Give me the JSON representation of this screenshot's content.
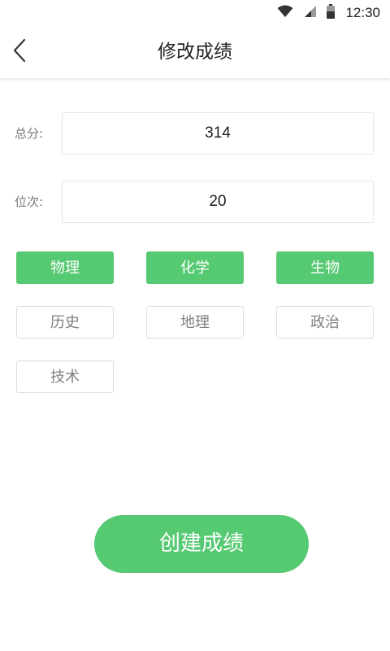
{
  "status_bar": {
    "time": "12:30",
    "icons": [
      "wifi-icon",
      "signal-icon",
      "battery-icon"
    ]
  },
  "header": {
    "title": "修改成绩",
    "back_icon": "chevron-left-icon"
  },
  "form": {
    "total_label": "总分:",
    "total_value": "314",
    "rank_label": "位次:",
    "rank_value": "20"
  },
  "subjects": [
    {
      "label": "物理",
      "selected": true
    },
    {
      "label": "化学",
      "selected": true
    },
    {
      "label": "生物",
      "selected": true
    },
    {
      "label": "历史",
      "selected": false
    },
    {
      "label": "地理",
      "selected": false
    },
    {
      "label": "政治",
      "selected": false
    },
    {
      "label": "技术",
      "selected": false
    }
  ],
  "create_button": "创建成绩",
  "colors": {
    "accent": "#56c973",
    "chip_border": "#dcdcdc",
    "text_muted": "#808080"
  }
}
